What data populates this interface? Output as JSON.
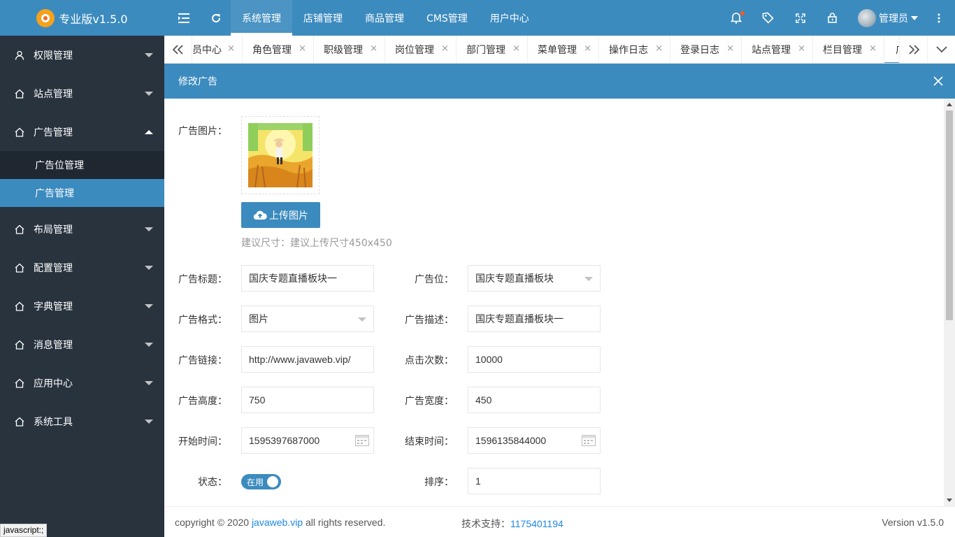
{
  "app": {
    "logo_text": "专业版v1.5.0",
    "colors": {
      "primary": "#3c8bbf",
      "sidebar": "#28333e",
      "logo": "#f7a21b",
      "badge": "#ff5722"
    }
  },
  "header": {
    "nav": [
      "系统管理",
      "店铺管理",
      "商品管理",
      "CMS管理",
      "用户中心"
    ],
    "active_nav": "系统管理",
    "user_name": "管理员",
    "icons": [
      "menu-fold-icon",
      "refresh-icon",
      "bell-icon",
      "tag-icon",
      "fullscreen-icon",
      "lock-icon",
      "more-vertical-icon"
    ]
  },
  "sidebar": {
    "items": [
      {
        "label": "权限管理",
        "icon": "user-icon"
      },
      {
        "label": "站点管理",
        "icon": "home-icon"
      },
      {
        "label": "广告管理",
        "icon": "home-icon",
        "expanded": true
      },
      {
        "label": "布局管理",
        "icon": "home-icon"
      },
      {
        "label": "配置管理",
        "icon": "home-icon"
      },
      {
        "label": "字典管理",
        "icon": "home-icon"
      },
      {
        "label": "消息管理",
        "icon": "home-icon"
      },
      {
        "label": "应用中心",
        "icon": "home-icon"
      },
      {
        "label": "系统工具",
        "icon": "home-icon"
      }
    ],
    "sub_items": [
      {
        "label": "广告位管理"
      },
      {
        "label": "广告管理",
        "active": true
      }
    ],
    "status_tip": "javascript:;"
  },
  "tabs": {
    "items": [
      {
        "label": "员中心"
      },
      {
        "label": "角色管理"
      },
      {
        "label": "职级管理"
      },
      {
        "label": "岗位管理"
      },
      {
        "label": "部门管理"
      },
      {
        "label": "菜单管理"
      },
      {
        "label": "操作日志"
      },
      {
        "label": "登录日志"
      },
      {
        "label": "站点管理"
      },
      {
        "label": "栏目管理"
      },
      {
        "label": "广"
      }
    ],
    "close_glyph": "×"
  },
  "dialog": {
    "title": "修改广告"
  },
  "form": {
    "image_label": "广告图片：",
    "upload_label": "上传图片",
    "hint": "建议尺寸：建议上传尺寸450x450",
    "title_label": "广告标题：",
    "title_value": "国庆专题直播板块一",
    "position_label": "广告位：",
    "position_value": "国庆专题直播板块",
    "format_label": "广告格式：",
    "format_value": "图片",
    "desc_label": "广告描述：",
    "desc_value": "国庆专题直播板块一",
    "link_label": "广告链接：",
    "link_value": "http://www.javaweb.vip/",
    "clicks_label": "点击次数：",
    "clicks_value": "10000",
    "height_label": "广告高度：",
    "height_value": "750",
    "width_label": "广告宽度：",
    "width_value": "450",
    "start_label": "开始时间：",
    "start_value": "1595397687000",
    "end_label": "结束时间：",
    "end_value": "1596135844000",
    "status_label": "状态：",
    "status_value": "在用",
    "sort_label": "排序：",
    "sort_value": "1"
  },
  "footer": {
    "copyright_prefix": "copyright © 2020 ",
    "copyright_link": "javaweb.vip",
    "copyright_suffix": " all rights reserved.",
    "support_label": "技术支持：",
    "support_value": "1175401194",
    "version": "Version v1.5.0"
  }
}
